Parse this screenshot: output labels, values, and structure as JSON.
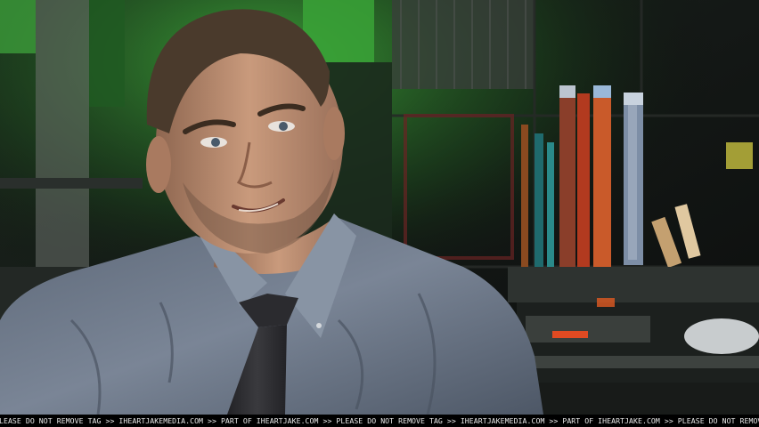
{
  "photo": {
    "subject": "man in grey button-down shirt and dark tie",
    "setting": "industrial workshop background with green lighting"
  },
  "watermark": {
    "text": "PLEASE DO NOT REMOVE TAG >> IHEARTJAKEMEDIA.COM >> PART OF IHEARTJAKE.COM >> PLEASE DO NOT REMOVE TAG >> IHEARTJAKEMEDIA.COM >> PART OF IHEARTJAKE.COM >> PLEASE DO NOT REMOVE TAG >> IHEARTJAKE"
  },
  "colors": {
    "shirt": "#6f7b8c",
    "tie": "#2e2e31",
    "skin": "#b98a6e",
    "hair": "#4a3a2c",
    "background_green": "#3fae3a"
  }
}
